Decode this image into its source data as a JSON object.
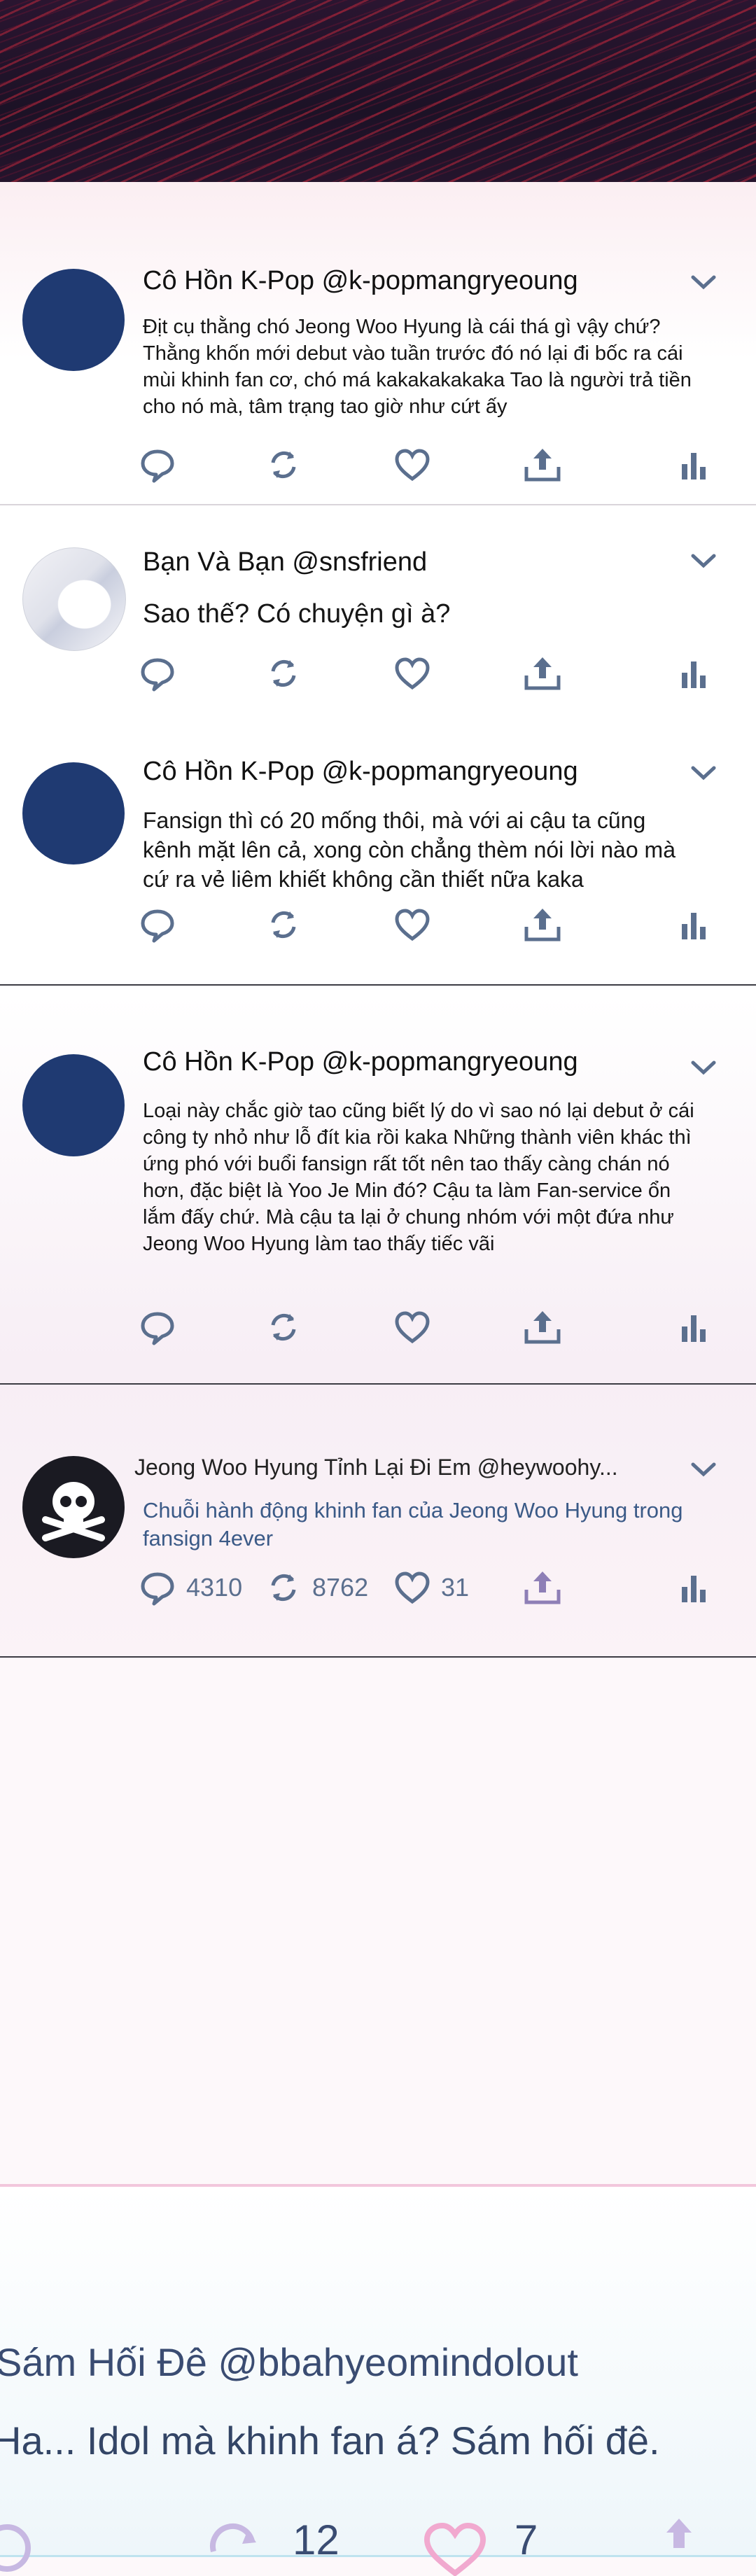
{
  "colors": {
    "icon": "#5b6f8e",
    "link": "#3b5a87",
    "avatar_navy": "#1f3a72",
    "share_purple": "#8e7fb6"
  },
  "tweets": [
    {
      "author": "Cô Hồn K-Pop @k-popmangryeoung",
      "avatar": "navy-circle-avatar",
      "text": "Địt cụ thằng chó Jeong Woo Hyung là cái thá gì vậy chứ? Thằng khốn mới debut vào tuần trước đó nó lại đi bốc ra cái mùi khinh fan cơ, chó má kakakakakaka Tao là người trả tiền cho nó mà, tâm trạng tao giờ như cứt ấy"
    },
    {
      "author": "Bạn Và Bạn @snsfriend",
      "avatar": "photo-avatar",
      "text": "Sao thế? Có chuyện gì à?"
    },
    {
      "author": "Cô Hồn K-Pop @k-popmangryeoung",
      "avatar": "navy-circle-avatar",
      "text": "Fansign thì có 20 mống thôi, mà với ai cậu ta cũng kênh mặt lên cả, xong còn chẳng thèm nói lời nào mà cứ ra vẻ liêm khiết không cần thiết nữa kaka"
    },
    {
      "author": "Cô Hồn K-Pop @k-popmangryeoung",
      "avatar": "navy-circle-avatar",
      "text": "Loại này chắc giờ tao cũng biết lý do vì sao nó lại debut ở cái công ty nhỏ như lỗ đít kia rồi kaka Những thành viên khác thì ứng phó với buổi fansign rất tốt nên tao thấy càng chán nó hơn, đặc biệt là Yoo Je Min đó? Cậu ta làm Fan-service ổn lắm đấy chứ. Mà cậu ta lại ở chung nhóm với một đứa như Jeong Woo Hyung làm tao thấy tiếc vãi"
    },
    {
      "author": "Jeong Woo Hyung Tỉnh Lại Đi Em @heywoohy...",
      "avatar": "skull-avatar",
      "text": "Chuỗi hành động khinh fan của Jeong Woo Hyung trong fansign 4ever",
      "replies": "4310",
      "retweets": "8762",
      "likes": "31"
    }
  ],
  "bottom_tweet": {
    "author": "Sám Hối Đê @bbahyeomindolout",
    "text": "Ha... Idol mà khinh fan á? Sám hối đê.",
    "retweets": "12",
    "likes": "7"
  }
}
